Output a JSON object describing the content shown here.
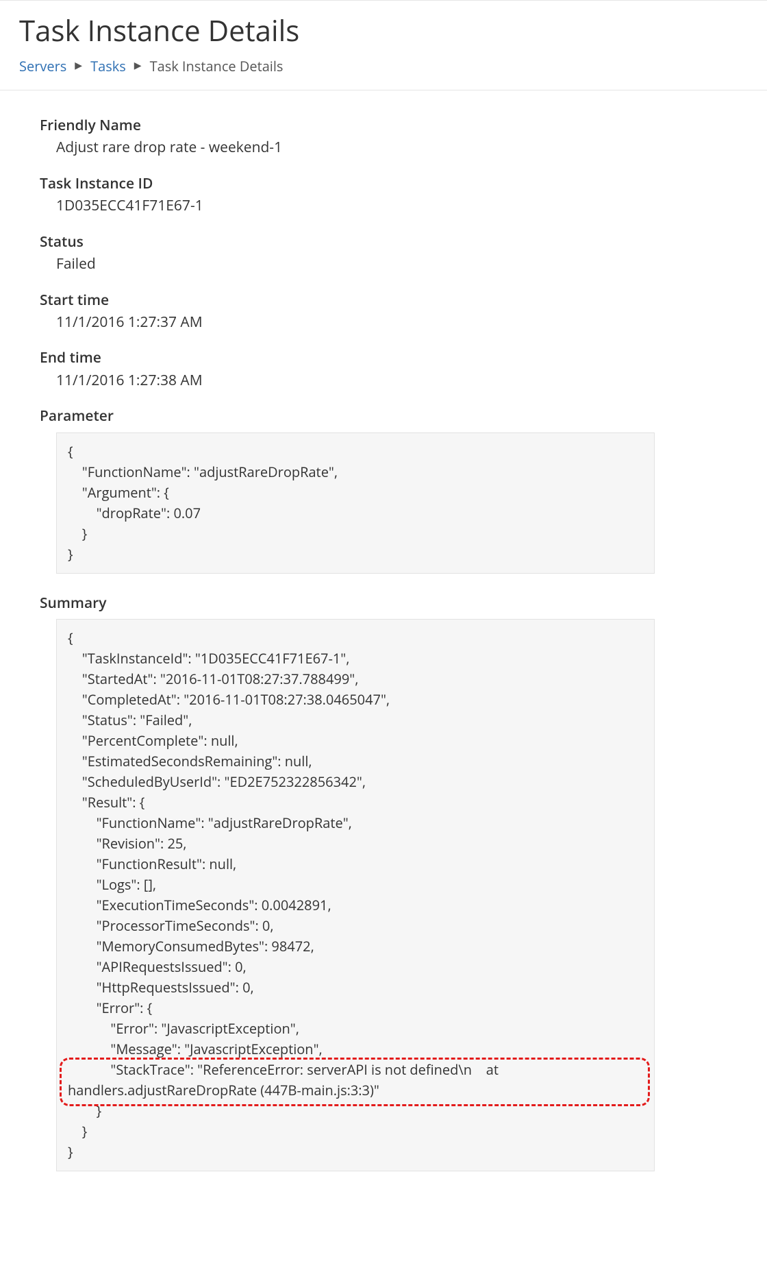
{
  "page": {
    "title": "Task Instance Details"
  },
  "breadcrumb": {
    "items": [
      {
        "label": "Servers",
        "link": true
      },
      {
        "label": "Tasks",
        "link": true
      },
      {
        "label": "Task Instance Details",
        "link": false
      }
    ]
  },
  "fields": {
    "friendly_name_label": "Friendly Name",
    "friendly_name_value": "Adjust rare drop rate - weekend-1",
    "task_instance_id_label": "Task Instance ID",
    "task_instance_id_value": "1D035ECC41F71E67-1",
    "status_label": "Status",
    "status_value": "Failed",
    "start_time_label": "Start time",
    "start_time_value": "11/1/2016 1:27:37 AM",
    "end_time_label": "End time",
    "end_time_value": "11/1/2016 1:27:38 AM"
  },
  "parameter": {
    "label": "Parameter",
    "text": "{\n    \"FunctionName\": \"adjustRareDropRate\",\n    \"Argument\": {\n        \"dropRate\": 0.07\n    }\n}"
  },
  "summary": {
    "label": "Summary",
    "text": "{\n    \"TaskInstanceId\": \"1D035ECC41F71E67-1\",\n    \"StartedAt\": \"2016-11-01T08:27:37.788499\",\n    \"CompletedAt\": \"2016-11-01T08:27:38.0465047\",\n    \"Status\": \"Failed\",\n    \"PercentComplete\": null,\n    \"EstimatedSecondsRemaining\": null,\n    \"ScheduledByUserId\": \"ED2E752322856342\",\n    \"Result\": {\n        \"FunctionName\": \"adjustRareDropRate\",\n        \"Revision\": 25,\n        \"FunctionResult\": null,\n        \"Logs\": [],\n        \"ExecutionTimeSeconds\": 0.0042891,\n        \"ProcessorTimeSeconds\": 0,\n        \"MemoryConsumedBytes\": 98472,\n        \"APIRequestsIssued\": 0,\n        \"HttpRequestsIssued\": 0,\n        \"Error\": {\n            \"Error\": \"JavascriptException\",\n            \"Message\": \"JavascriptException\",\n            \"StackTrace\": \"ReferenceError: serverAPI is not defined\\n    at handlers.adjustRareDropRate (447B-main.js:3:3)\"\n        }\n    }\n}",
    "highlighted_fragment": "\"StackTrace\": \"ReferenceError: serverAPI is not defined\\n    at handlers.adjustRareDropRate (447B-main.js:3:3)\""
  }
}
